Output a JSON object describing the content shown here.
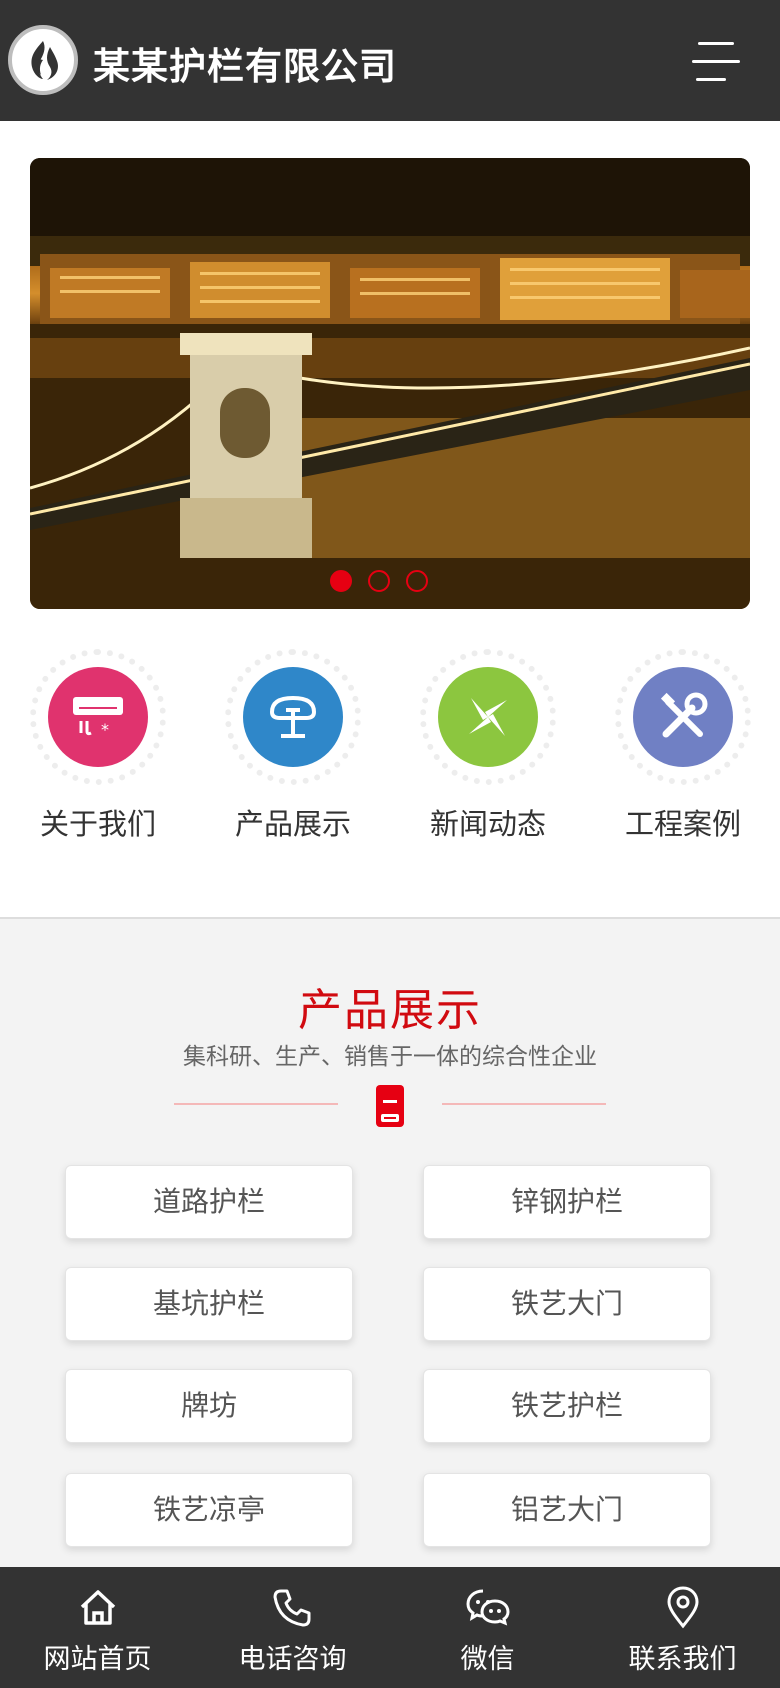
{
  "header": {
    "brand": "某某护栏有限公司",
    "logo_icon": "flame-logo-icon",
    "menu_icon": "hamburger-menu-icon"
  },
  "banner": {
    "slide_count": 3,
    "active_slide": 1,
    "accent_color": "#e60012"
  },
  "quick_nav": [
    {
      "label": "关于我们",
      "icon": "air-conditioner-icon",
      "color": "#e0336e"
    },
    {
      "label": "产品展示",
      "icon": "product-stand-icon",
      "color": "#2f87c9"
    },
    {
      "label": "新闻动态",
      "icon": "pinwheel-icon",
      "color": "#8cc63f"
    },
    {
      "label": "工程案例",
      "icon": "tools-icon",
      "color": "#7080c4"
    }
  ],
  "products": {
    "title": "产品展示",
    "subtitle": "集科研、生产、销售于一体的综合性企业",
    "title_color": "#d10a10",
    "items": [
      "道路护栏",
      "锌钢护栏",
      "基坑护栏",
      "铁艺大门",
      "牌坊",
      "铁艺护栏",
      "铁艺凉亭",
      "铝艺大门"
    ]
  },
  "tabbar": [
    {
      "label": "网站首页",
      "icon": "home-icon"
    },
    {
      "label": "电话咨询",
      "icon": "phone-icon"
    },
    {
      "label": "微信",
      "icon": "wechat-icon"
    },
    {
      "label": "联系我们",
      "icon": "location-pin-icon"
    }
  ]
}
